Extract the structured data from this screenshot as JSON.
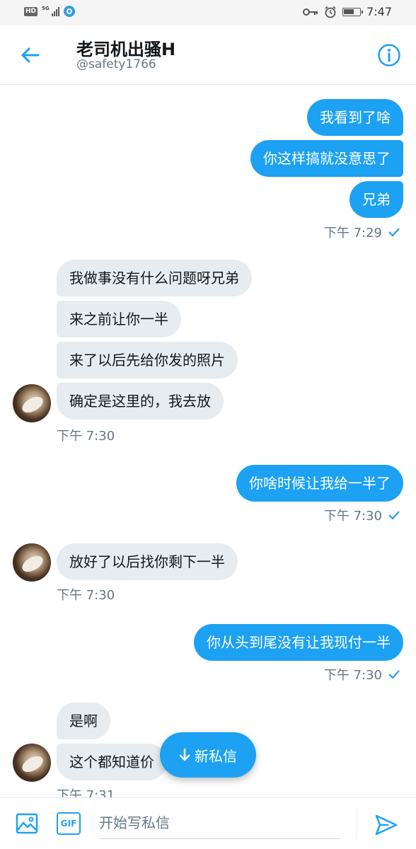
{
  "status_bar": {
    "hd_badge": "HD",
    "network": "5G",
    "time": "7:47"
  },
  "header": {
    "title": "老司机出骚H",
    "handle": "@safety1766"
  },
  "messages": {
    "out1": [
      "我看到了啥",
      "你这样搞就没意思了",
      "兄弟"
    ],
    "out1_time": "下午 7:29",
    "in1": [
      "我做事没有什么问题呀兄弟",
      "来之前让你一半",
      "来了以后先给你发的照片",
      "确定是这里的，我去放"
    ],
    "in1_time": "下午 7:30",
    "out2": [
      "你啥时候让我给一半了"
    ],
    "out2_time": "下午 7:30",
    "in2": [
      "放好了以后找你剩下一半"
    ],
    "in2_time": "下午 7:30",
    "out3": [
      "你从头到尾没有让我现付一半"
    ],
    "out3_time": "下午 7:30",
    "in3": [
      "是啊",
      "这个都知道价"
    ],
    "in3_time": "下午 7:31"
  },
  "new_message_button": {
    "label": "新私信"
  },
  "composer": {
    "gif_label": "GIF",
    "placeholder": "开始写私信"
  },
  "colors": {
    "accent": "#1da1f2",
    "incoming_bubble": "#e6ecf0",
    "muted_text": "#657786"
  },
  "icons": [
    "back-arrow-icon",
    "info-icon",
    "read-check-icon",
    "image-icon",
    "gif-icon",
    "send-icon",
    "arrow-down-icon",
    "key-icon",
    "alarm-icon",
    "battery-icon",
    "signal-icon"
  ]
}
